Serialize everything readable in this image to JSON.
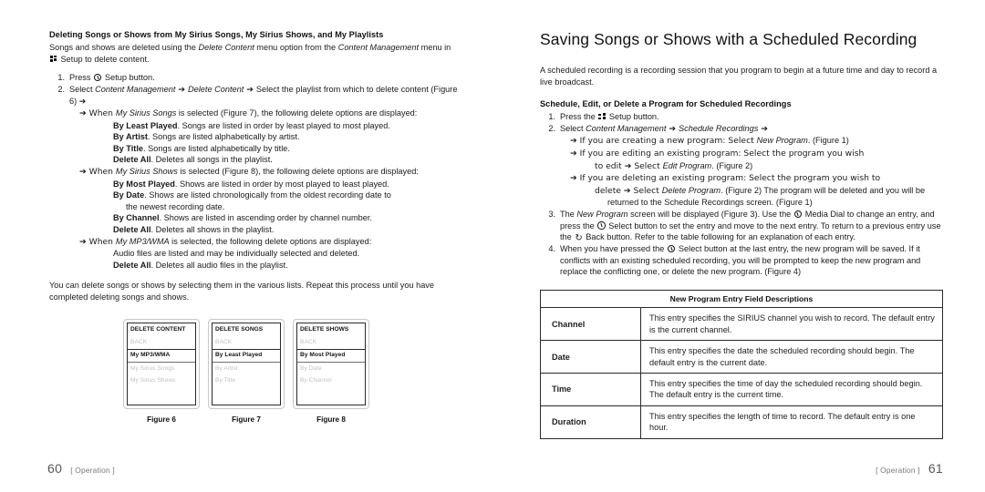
{
  "left_page": {
    "heading": "Deleting Songs or Shows from My Sirius Songs, My Sirius Shows, and My Playlists",
    "intro_1": "Songs and shows are deleted using the ",
    "intro_em_1": "Delete Content",
    "intro_2": " menu option from the ",
    "intro_em_2": "Content Management",
    "intro_3": " menu in ",
    "intro_4": " Setup to delete content.",
    "step1_num": "1.",
    "step1_a": "Press ",
    "step1_b": " Setup button.",
    "step2_num": "2.",
    "step2_a": "Select ",
    "step2_em_1": "Content Management",
    "step2_arrow_1": " ➔ ",
    "step2_em_2": "Delete Content",
    "step2_arrow_2": " ➔ ",
    "step2_b": "Select the playlist from which to delete content (Figure 6) ➔",
    "songs_intro_a": "➔ When ",
    "songs_intro_em": "My Sirius Songs",
    "songs_intro_b": " is selected (Figure 7), the following delete options are displayed:",
    "songs_options": [
      {
        "term": "By Least Played",
        "desc": ". Songs are listed in order by least played to most played."
      },
      {
        "term": "By Artist",
        "desc": ". Songs are listed alphabetically by artist."
      },
      {
        "term": "By Title",
        "desc": ". Songs are listed alphabetically by title."
      },
      {
        "term": "Delete All",
        "desc": ". Deletes all songs in the playlist."
      }
    ],
    "shows_intro_a": "➔ When ",
    "shows_intro_em": "My Sirius Shows",
    "shows_intro_b": " is selected (Figure 8), the following delete options are displayed:",
    "shows_options": [
      {
        "term": "By Most Played",
        "desc": ". Shows are listed in order by most played to least played."
      },
      {
        "term": "By Date",
        "desc": ". Shows are listed chronologically from the oldest recording date to",
        "cont": "the newest recording date."
      },
      {
        "term": "By Channel",
        "desc": ". Shows are listed in ascending order by channel number."
      },
      {
        "term": "Delete All",
        "desc": ". Deletes all shows in the playlist."
      }
    ],
    "mp3_intro_a": "➔ When ",
    "mp3_intro_em": "My MP3/WMA",
    "mp3_intro_b": " is selected, the following delete options are displayed:",
    "mp3_line_1": "Audio files are listed and may be individually selected and deleted.",
    "mp3_term": "Delete All",
    "mp3_desc": ". Deletes all audio files in the playlist.",
    "closing": "You can delete songs or shows by selecting them in the various lists. Repeat this process until you have completed deleting songs and shows.",
    "figures": [
      {
        "caption": "Figure 6",
        "title": "DELETE CONTENT",
        "back": "BACK",
        "selected": "My MP3/WMA",
        "dim_items": [
          "My Sirius Songs",
          "My Sirius Shows"
        ]
      },
      {
        "caption": "Figure 7",
        "title": "DELETE SONGS",
        "back": "BACK",
        "selected": "By Least Played",
        "dim_items": [
          "By Artist",
          "By Title"
        ]
      },
      {
        "caption": "Figure 8",
        "title": "DELETE SHOWS",
        "back": "BACK",
        "selected": "By Most Played",
        "dim_items": [
          "By Date",
          "By Channel"
        ]
      }
    ],
    "footer": {
      "page_number": "60",
      "label": "[ Operation ]"
    }
  },
  "right_page": {
    "title": "Saving Songs or Shows with a Scheduled Recording",
    "intro": "A scheduled recording is a recording session that you program to begin at a future time and day to record a live broadcast.",
    "sub_head": "Schedule, Edit, or Delete a Program for Scheduled Recordings",
    "step1_num": "1.",
    "step1_a": "Press the ",
    "step1_b": " Setup button.",
    "step2_num": "2.",
    "step2_a": "Select ",
    "step2_em_1": "Content Management",
    "step2_arrow_1": " ➔ ",
    "step2_em_2": "Schedule Recordings",
    "step2_arrow_2": " ➔",
    "step2_sub_1_a": "➔ If you are creating a new program: Select ",
    "step2_sub_1_em": "New Program",
    "step2_sub_1_b": ". (Figure 1)",
    "step2_sub_2_a": "➔ If you are editing an existing program: Select the program you wish",
    "step2_sub_2_cont_a": "to edit ➔ Select ",
    "step2_sub_2_cont_em": "Edit Program",
    "step2_sub_2_cont_b": ". (Figure 2)",
    "step2_sub_3_a": "➔ If you are deleting an existing program: Select the program you wish to",
    "step2_sub_3_cont_a": "delete ➔ Select ",
    "step2_sub_3_cont_em": "Delete Program",
    "step2_sub_3_cont_b": ". (Figure 2) The program will be deleted and you will be",
    "step2_sub_3_cont2": "returned to the Schedule Recordings screen. (Figure 1)",
    "step3_num": "3.",
    "step3_a": "The ",
    "step3_em": "New Program",
    "step3_b": " screen will be displayed (Figure 3). Use the ",
    "step3_c": " Media Dial to change an entry, and press the ",
    "step3_d": " Select button to set the entry and move to the next entry. To return to a previous entry use the ",
    "step3_e": " Back button. Refer to the table following for an explanation of each entry.",
    "step4_num": "4.",
    "step4_a": "When you have pressed the ",
    "step4_b": " Select button at the last entry, the new program will be saved. If it conflicts with an existing scheduled recording, you will be prompted to keep the new program and replace the conflicting one, or delete the new program. (Figure 4)",
    "table": {
      "header": "New Program Entry Field Descriptions",
      "rows": [
        {
          "label": "Channel",
          "desc": "This entry specifies the SIRIUS channel you wish to record. The default entry is the current channel."
        },
        {
          "label": "Date",
          "desc": "This entry specifies the date the scheduled recording should begin. The default entry is the current date."
        },
        {
          "label": "Time",
          "desc": "This entry specifies the time of day the scheduled recording should begin. The default entry is the current time."
        },
        {
          "label": "Duration",
          "desc": "This entry specifies the length of time to record. The default entry is one hour."
        }
      ]
    },
    "footer": {
      "page_number": "61",
      "label": "[ Operation ]"
    }
  },
  "icons": {
    "setup": "setup-grid-icon",
    "select": "select-dial-icon",
    "back": "back-arrow-icon"
  }
}
